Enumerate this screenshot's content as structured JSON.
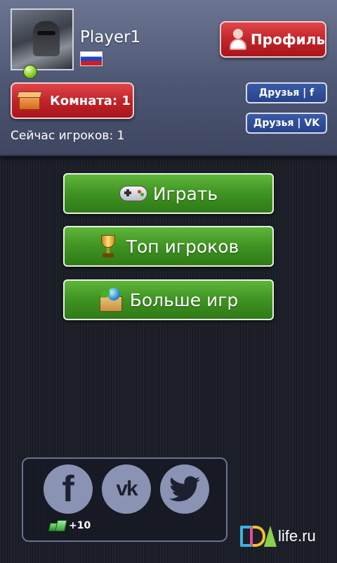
{
  "header": {
    "player_name": "Player1",
    "profile_label": "Профиль",
    "room_label": "Комната: 1",
    "players_online": "Сейчас игроков: 1",
    "friends_fb_label": "Друзья | f",
    "friends_vk_label": "Друзья | VK",
    "flag_country": "Russia"
  },
  "menu": {
    "play_label": "Играть",
    "top_label": "Топ игроков",
    "more_label": "Больше игр"
  },
  "social": {
    "facebook_glyph": "f",
    "vk_glyph": "vk",
    "bonus_text": "+10"
  },
  "watermark": {
    "text": "life.ru"
  },
  "icons": [
    "person-icon",
    "box-icon",
    "gamepad-icon",
    "trophy-icon",
    "package-icon",
    "facebook-icon",
    "vk-icon",
    "twitter-icon",
    "gem-icon"
  ],
  "colors": {
    "red_button": "#c2242a",
    "green_button": "#3f9322",
    "blue_button": "#27438a",
    "social_circle": "#8a93b3",
    "header_bg": "#4d5673"
  }
}
